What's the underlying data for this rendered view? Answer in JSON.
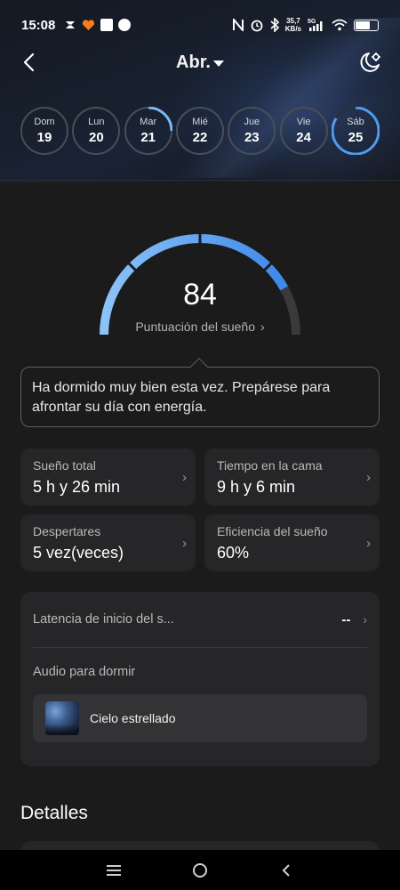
{
  "status_bar": {
    "time": "15:08",
    "net_speed_value": "35,7",
    "net_speed_unit": "KB/s",
    "signal_label": "5G",
    "icons": [
      "notification-icon",
      "alarm-icon",
      "bluetooth-icon",
      "wifi-icon",
      "battery-icon"
    ]
  },
  "header": {
    "month": "Abr."
  },
  "days": [
    {
      "name": "Dom",
      "num": "19",
      "progress": 0
    },
    {
      "name": "Lun",
      "num": "20",
      "progress": 0
    },
    {
      "name": "Mar",
      "num": "21",
      "progress": 0.25
    },
    {
      "name": "Mié",
      "num": "22",
      "progress": 0
    },
    {
      "name": "Jue",
      "num": "23",
      "progress": 0
    },
    {
      "name": "Vie",
      "num": "24",
      "progress": 0
    },
    {
      "name": "Sáb",
      "num": "25",
      "progress": 0.84,
      "selected": true
    }
  ],
  "score": {
    "value": "84",
    "fraction": 0.84,
    "label": "Puntuación del sueño",
    "chevron": "›"
  },
  "tip": {
    "text": "Ha dormido muy bien esta vez. Prepárese para afrontar su día con energía."
  },
  "stats": {
    "total_sleep": {
      "label": "Sueño total",
      "value": "5 h y 26 min"
    },
    "time_in_bed": {
      "label": "Tiempo en la cama",
      "value": "9 h y 6 min"
    },
    "awakenings": {
      "label": "Despertares",
      "value": "5 vez(veces)"
    },
    "efficiency": {
      "label": "Eficiencia del sueño",
      "value": "60%"
    },
    "chevron": "›"
  },
  "panel": {
    "latency_label": "Latencia de inicio del s...",
    "latency_value": "--",
    "chevron": "›",
    "audio_label": "Audio para dormir",
    "audio_name": "Cielo estrellado"
  },
  "details": {
    "title": "Detalles"
  },
  "colors": {
    "accent": "#4f9cf0",
    "accent_light": "#7db8f5",
    "track": "#3a3a3d",
    "card": "#262628",
    "background": "#1b1b1c"
  }
}
